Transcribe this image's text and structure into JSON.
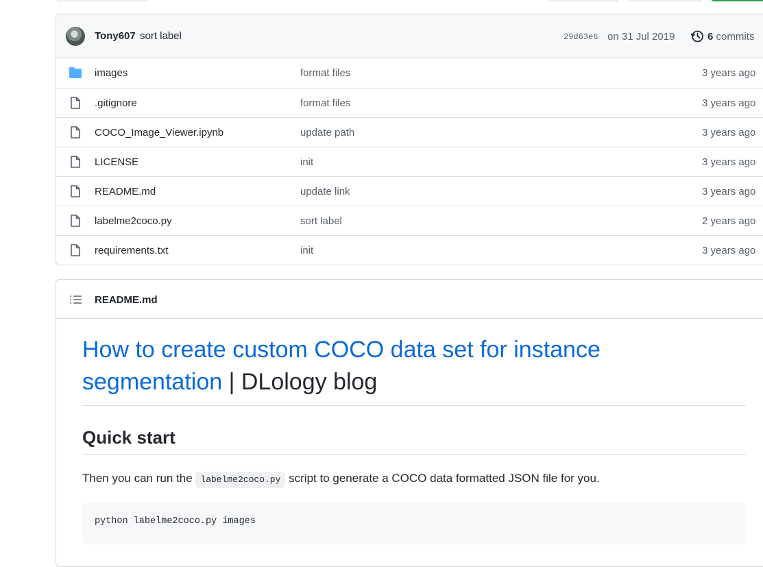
{
  "latest_commit": {
    "author": "Tony607",
    "message": "sort label",
    "sha": "29d63e6",
    "date": "on 31 Jul 2019",
    "commit_count": "6",
    "commits_label": "commits",
    "avatar_icon": "user-avatar"
  },
  "files": [
    {
      "icon": "folder-icon",
      "name": "images",
      "commit": "format files",
      "age": "3 years ago"
    },
    {
      "icon": "file-icon",
      "name": ".gitignore",
      "commit": "format files",
      "age": "3 years ago"
    },
    {
      "icon": "file-icon",
      "name": "COCO_Image_Viewer.ipynb",
      "commit": "update path",
      "age": "3 years ago"
    },
    {
      "icon": "file-icon",
      "name": "LICENSE",
      "commit": "init",
      "age": "3 years ago"
    },
    {
      "icon": "file-icon",
      "name": "README.md",
      "commit": "update link",
      "age": "3 years ago"
    },
    {
      "icon": "file-icon",
      "name": "labelme2coco.py",
      "commit": "sort label",
      "age": "2 years ago"
    },
    {
      "icon": "file-icon",
      "name": "requirements.txt",
      "commit": "init",
      "age": "3 years ago"
    }
  ],
  "readme": {
    "header_title": "README.md",
    "h1_link": "How to create custom COCO data set for instance segmentation",
    "h1_rest": " | DLology blog",
    "h2": "Quick start",
    "para_before": "Then you can run the ",
    "para_code": "labelme2coco.py",
    "para_after": " script to generate a COCO data formatted JSON file for you.",
    "code_block": "python labelme2coco.py images"
  },
  "colors": {
    "link": "#0969da",
    "folder": "#54aeff",
    "muted": "#57606a",
    "border": "#d0d7de"
  }
}
